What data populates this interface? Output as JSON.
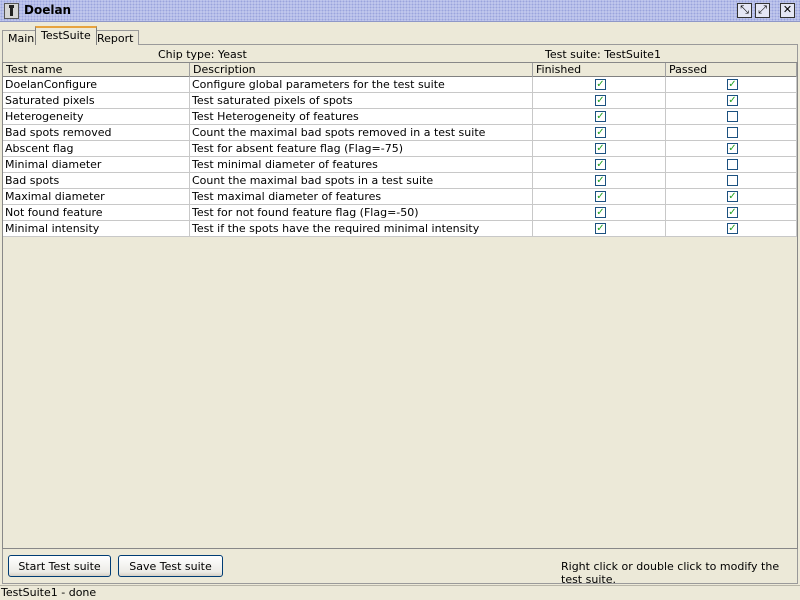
{
  "window": {
    "title": "Doelan",
    "controls": {
      "minimize": "⤡",
      "maximize": "⤢",
      "close": "✕"
    }
  },
  "tabs": [
    {
      "label": "Main"
    },
    {
      "label": "TestSuite",
      "selected": true
    },
    {
      "label": "Report"
    }
  ],
  "info": {
    "chip_type": "Chip type: Yeast",
    "test_suite": "Test suite: TestSuite1"
  },
  "table": {
    "columns": [
      "Test name",
      "Description",
      "Finished",
      "Passed"
    ],
    "rows": [
      {
        "name": "DoelanConfigure",
        "description": "Configure global parameters for the test suite",
        "finished": true,
        "passed": true
      },
      {
        "name": "Saturated pixels",
        "description": "Test saturated pixels of spots",
        "finished": true,
        "passed": true
      },
      {
        "name": "Heterogeneity",
        "description": "Test Heterogeneity of features",
        "finished": true,
        "passed": false
      },
      {
        "name": "Bad spots removed",
        "description": "Count the maximal bad spots removed in a test suite",
        "finished": true,
        "passed": false
      },
      {
        "name": "Abscent flag",
        "description": "Test for absent feature flag (Flag=-75)",
        "finished": true,
        "passed": true
      },
      {
        "name": "Minimal diameter",
        "description": "Test minimal diameter of features",
        "finished": true,
        "passed": false
      },
      {
        "name": "Bad spots",
        "description": "Count the maximal bad spots in a test suite",
        "finished": true,
        "passed": false
      },
      {
        "name": "Maximal diameter",
        "description": "Test maximal diameter of features",
        "finished": true,
        "passed": true
      },
      {
        "name": "Not found feature",
        "description": "Test for not found feature flag (Flag=-50)",
        "finished": true,
        "passed": true
      },
      {
        "name": "Minimal intensity",
        "description": "Test if the spots have the required minimal intensity",
        "finished": true,
        "passed": true
      }
    ]
  },
  "buttons": {
    "start": "Start Test suite",
    "save": "Save Test suite"
  },
  "hint": "Right click or double click to modify the test suite.",
  "status": "TestSuite1 - done",
  "colors": {
    "checkmark": "#21A121",
    "selected_tab_accent": "#E7A33E",
    "background": "#ECE9D8"
  }
}
